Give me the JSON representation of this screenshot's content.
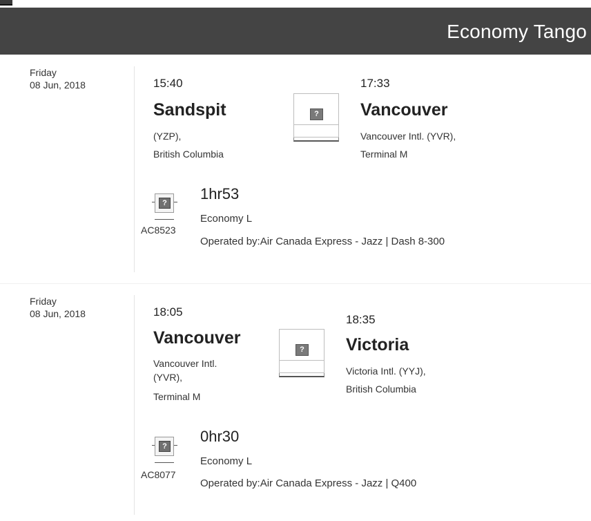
{
  "header": {
    "title": "Economy Tango"
  },
  "segments": [
    {
      "day": "Friday",
      "date": "08 Jun, 2018",
      "depart": {
        "time": "15:40",
        "city": "Sandspit",
        "airport": "(YZP),",
        "region": "British Columbia"
      },
      "arrive": {
        "time": "17:33",
        "city": "Vancouver",
        "airport": "Vancouver Intl. (YVR),",
        "region": "Terminal M"
      },
      "flight_no": "AC8523",
      "duration": "1hr53",
      "cabin": "Economy L",
      "operated": "Operated by:Air Canada Express - Jazz | Dash 8-300"
    },
    {
      "day": "Friday",
      "date": "08 Jun, 2018",
      "depart": {
        "time": "18:05",
        "city": "Vancouver",
        "airport_line1": "Vancouver Intl.",
        "airport_line2": "(YVR),",
        "region": "Terminal M"
      },
      "arrive": {
        "time": "18:35",
        "city": "Victoria",
        "airport": "Victoria Intl. (YYJ),",
        "region": "British Columbia"
      },
      "flight_no": "AC8077",
      "duration": "0hr30",
      "cabin": "Economy L",
      "operated": "Operated by:Air Canada Express - Jazz | Q400"
    }
  ],
  "icons": {
    "placeholder_glyph": "?",
    "plane_image": "broken-image-icon",
    "airline_logo": "broken-image-icon"
  }
}
